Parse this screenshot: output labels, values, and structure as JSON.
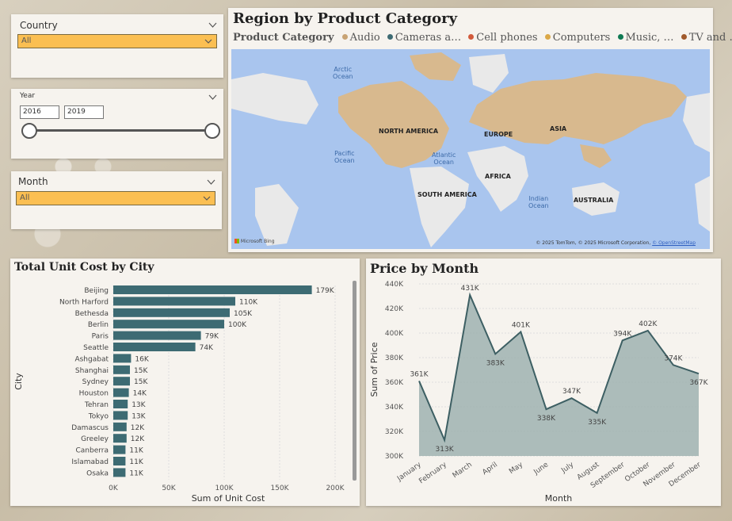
{
  "slicers": {
    "country": {
      "title": "Country",
      "value": "All"
    },
    "year": {
      "title": "Year",
      "from": "2016",
      "to": "2019"
    },
    "month": {
      "title": "Month",
      "value": "All"
    }
  },
  "map_visual": {
    "title": "Region by Product Category",
    "legend_title": "Product Category",
    "legend_items": [
      {
        "label": "Audio",
        "color": "#c8a374"
      },
      {
        "label": "Cameras a…",
        "color": "#3d6b73"
      },
      {
        "label": "Cell phones",
        "color": "#d25b3c"
      },
      {
        "label": "Computers",
        "color": "#dba847"
      },
      {
        "label": "Music, …",
        "color": "#0f7a53"
      },
      {
        "label": "TV and …",
        "color": "#a05a2c"
      }
    ],
    "continent_labels": [
      "NORTH AMERICA",
      "EUROPE",
      "ASIA",
      "AFRICA",
      "SOUTH AMERICA",
      "AUSTRALIA"
    ],
    "ocean_labels": [
      "Arctic Ocean",
      "Pacific Ocean",
      "Atlantic Ocean",
      "Indian Ocean"
    ],
    "ocean_lines": [
      [
        "Arctic",
        "Ocean"
      ],
      [
        "Pacific",
        "Ocean"
      ],
      [
        "Atlantic",
        "Ocean"
      ],
      [
        "Indian",
        "Ocean"
      ]
    ],
    "provider": "Microsoft Bing",
    "attribution": "© 2025 TomTom, © 2025 Microsoft Corporation,",
    "attribution_link": "© OpenStreetMap"
  },
  "colors": {
    "bar": "#3d6b73",
    "area_fill": "#9fb1b0",
    "line": "#3d5f63",
    "slicer_fill": "#fbbf52"
  },
  "chart_data": [
    {
      "type": "bar",
      "title": "Total Unit Cost by City",
      "xlabel": "Sum of Unit Cost",
      "ylabel": "City",
      "categories": [
        "Beijing",
        "North Harford",
        "Bethesda",
        "Berlin",
        "Paris",
        "Seattle",
        "Ashgabat",
        "Shanghai",
        "Sydney",
        "Houston",
        "Tehran",
        "Tokyo",
        "Damascus",
        "Greeley",
        "Canberra",
        "Islamabad",
        "Osaka"
      ],
      "values": [
        179000,
        110000,
        105000,
        100000,
        79000,
        74000,
        16000,
        15000,
        15000,
        14000,
        13000,
        13000,
        12000,
        12000,
        11000,
        11000,
        11000
      ],
      "data_labels": [
        "179K",
        "110K",
        "105K",
        "100K",
        "79K",
        "74K",
        "16K",
        "15K",
        "15K",
        "14K",
        "13K",
        "13K",
        "12K",
        "12K",
        "11K",
        "11K",
        "11K"
      ],
      "xlim": [
        0,
        200000
      ],
      "xticks": [
        0,
        50000,
        100000,
        150000,
        200000
      ],
      "xtick_labels": [
        "0K",
        "50K",
        "100K",
        "150K",
        "200K"
      ],
      "grid": true
    },
    {
      "type": "area",
      "title": "Price by Month",
      "xlabel": "Month",
      "ylabel": "Sum of Price",
      "categories": [
        "January",
        "February",
        "March",
        "April",
        "May",
        "June",
        "July",
        "August",
        "September",
        "October",
        "November",
        "December"
      ],
      "values": [
        361000,
        313000,
        431000,
        383000,
        401000,
        338000,
        347000,
        335000,
        394000,
        402000,
        374000,
        367000
      ],
      "data_labels": [
        "361K",
        "313K",
        "431K",
        "383K",
        "401K",
        "338K",
        "347K",
        "335K",
        "394K",
        "402K",
        "374K",
        "367K"
      ],
      "ylim": [
        300000,
        440000
      ],
      "yticks": [
        300000,
        320000,
        340000,
        360000,
        380000,
        400000,
        420000,
        440000
      ],
      "ytick_labels": [
        "300K",
        "320K",
        "340K",
        "360K",
        "380K",
        "400K",
        "420K",
        "440K"
      ],
      "grid": true
    }
  ]
}
